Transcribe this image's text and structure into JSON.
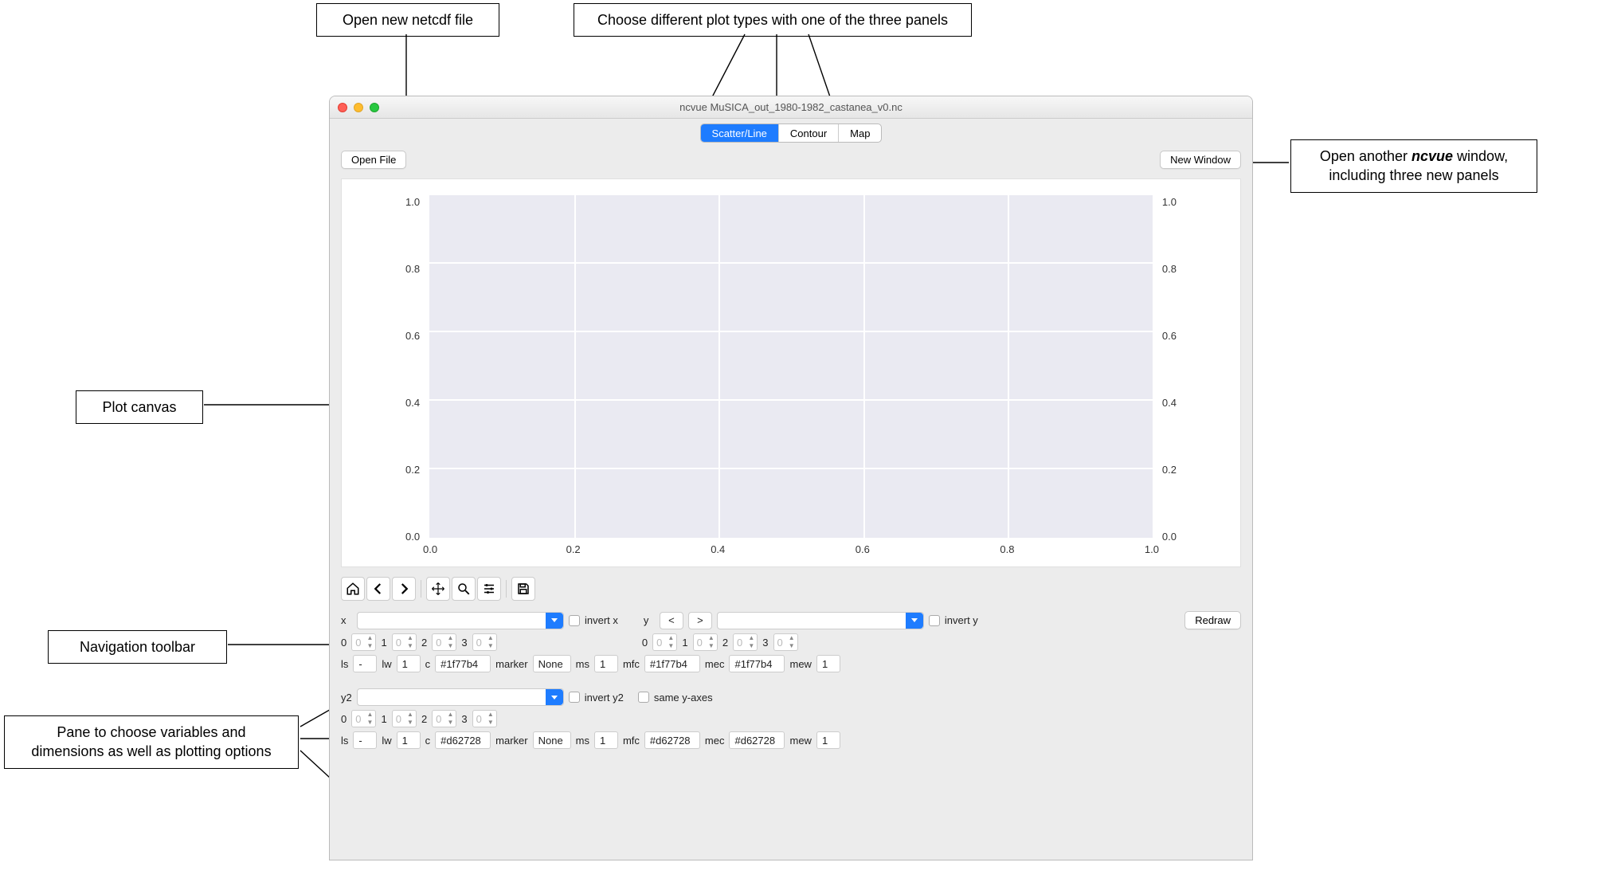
{
  "callouts": {
    "open_file": "Open new netcdf file",
    "plot_types": "Choose different plot types with one of the three panels",
    "new_window_a": "Open another ",
    "new_window_b": "ncvue",
    "new_window_c": " window,\nincluding three new panels",
    "plot_canvas": "Plot canvas",
    "nav_toolbar": "Navigation toolbar",
    "options_pane": "Pane to choose variables and\ndimensions as well as plotting options"
  },
  "window": {
    "title": "ncvue MuSICA_out_1980-1982_castanea_v0.nc"
  },
  "tabs": {
    "scatter": "Scatter/Line",
    "contour": "Contour",
    "map": "Map"
  },
  "buttons": {
    "open_file": "Open File",
    "new_window": "New Window",
    "redraw": "Redraw"
  },
  "chart_data": {
    "type": "scatter",
    "title": "",
    "xlabel": "",
    "ylabel": "",
    "xlim": [
      0.0,
      1.0
    ],
    "ylim": [
      0.0,
      1.0
    ],
    "xticks": [
      0.0,
      0.2,
      0.4,
      0.6,
      0.8,
      1.0
    ],
    "yticks_left": [
      0.0,
      0.2,
      0.4,
      0.6,
      0.8,
      1.0
    ],
    "yticks_right": [
      0.0,
      0.2,
      0.4,
      0.6,
      0.8,
      1.0
    ],
    "series": []
  },
  "axes": {
    "xticks": [
      "0.0",
      "0.2",
      "0.4",
      "0.6",
      "0.8",
      "1.0"
    ],
    "yticks": [
      "0.0",
      "0.2",
      "0.4",
      "0.6",
      "0.8",
      "1.0"
    ]
  },
  "controls": {
    "x_label": "x",
    "invert_x": "invert x",
    "y_label": "y",
    "y_lt": "<",
    "y_gt": ">",
    "invert_y": "invert y",
    "dims_labels": [
      "0",
      "1",
      "2",
      "3"
    ],
    "dims_vals": [
      "0",
      "0",
      "0",
      "0"
    ],
    "line1": {
      "ls_lbl": "ls",
      "ls": "-",
      "lw_lbl": "lw",
      "lw": "1",
      "c_lbl": "c",
      "c": "#1f77b4",
      "marker_lbl": "marker",
      "marker": "None",
      "ms_lbl": "ms",
      "ms": "1",
      "mfc_lbl": "mfc",
      "mfc": "#1f77b4",
      "mec_lbl": "mec",
      "mec": "#1f77b4",
      "mew_lbl": "mew",
      "mew": "1"
    },
    "y2_label": "y2",
    "invert_y2": "invert y2",
    "same_axes": "same y-axes",
    "line2": {
      "ls_lbl": "ls",
      "ls": "-",
      "lw_lbl": "lw",
      "lw": "1",
      "c_lbl": "c",
      "c": "#d62728",
      "marker_lbl": "marker",
      "marker": "None",
      "ms_lbl": "ms",
      "ms": "1",
      "mfc_lbl": "mfc",
      "mfc": "#d62728",
      "mec_lbl": "mec",
      "mec": "#d62728",
      "mew_lbl": "mew",
      "mew": "1"
    }
  }
}
